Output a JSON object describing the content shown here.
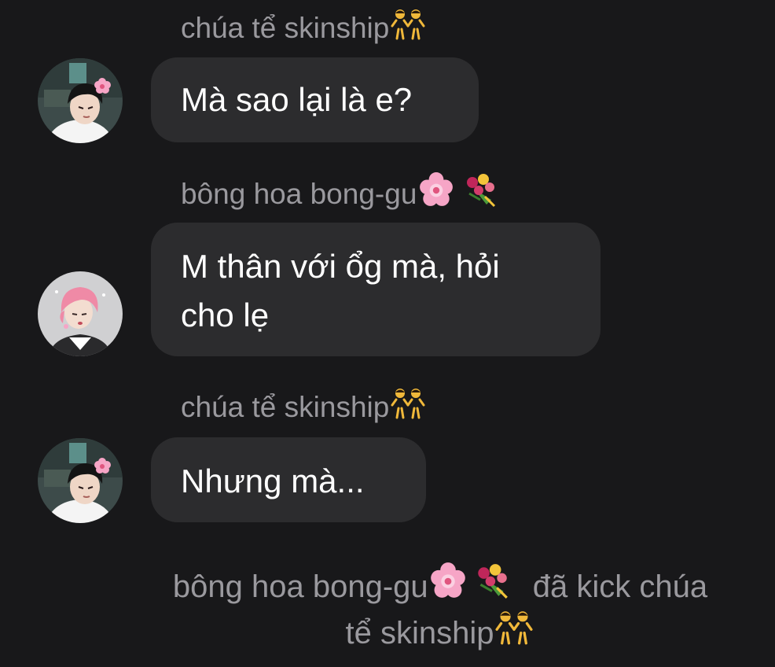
{
  "messages": [
    {
      "sender": "chúa tể skinship",
      "sender_emoji": [
        "dancers-icon"
      ],
      "text": "Mà sao lại là e?",
      "avatar": "avatar-boy-dark-hair"
    },
    {
      "sender": "bông hoa bong-gu",
      "sender_emoji": [
        "cherry-blossom-icon",
        "bouquet-icon"
      ],
      "text_lines": [
        "M thân với ổg mà, hỏi",
        "cho lẹ"
      ],
      "avatar": "avatar-pink-hair"
    },
    {
      "sender": "chúa tể skinship",
      "sender_emoji": [
        "dancers-icon"
      ],
      "text": "Nhưng mà...",
      "avatar": "avatar-boy-dark-hair"
    }
  ],
  "system_notice": {
    "actor": "bông hoa bong-gu",
    "action": "đã kick chúa",
    "target": "tể skinship"
  },
  "colors": {
    "background": "#18181a",
    "bubble": "#2c2c2e",
    "secondary_text": "#9a999e",
    "primary_text": "#ffffff"
  }
}
